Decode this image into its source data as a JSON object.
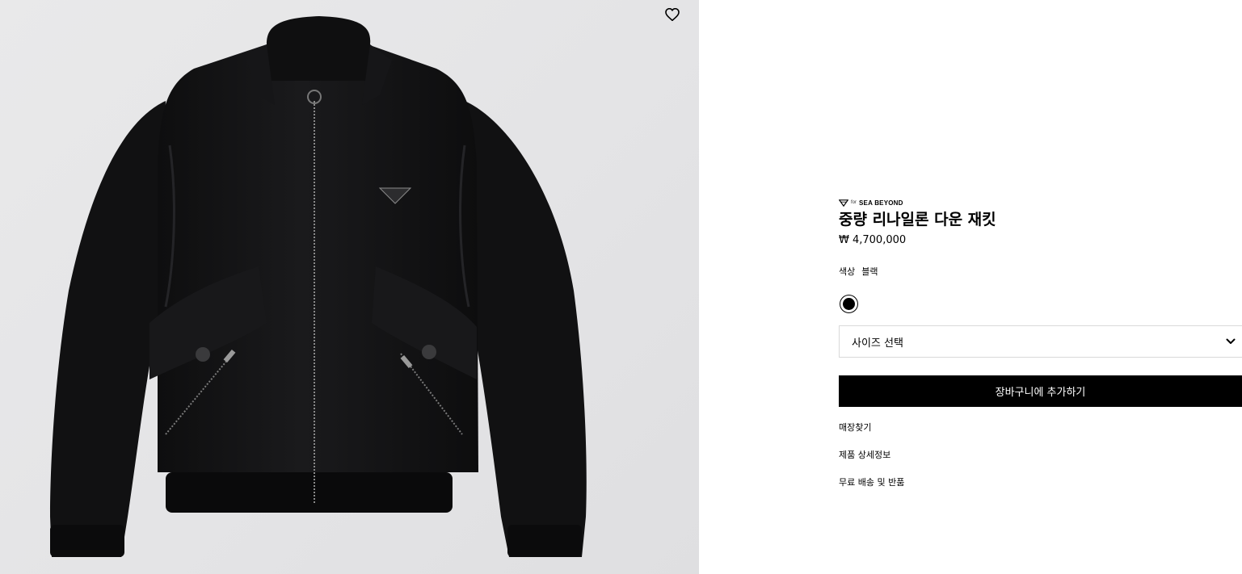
{
  "product": {
    "badge_for": "for",
    "badge_brand": "SEA BEYOND",
    "title": "중량 리나일론 다운 재킷",
    "price": "₩ 4,700,000",
    "color_label": "색상",
    "color_value": "블랙",
    "swatch_color": "#000000",
    "size_select_label": "사이즈 선택",
    "add_to_cart_label": "장바구니에 추가하기"
  },
  "links": {
    "find_store": "매장찾기",
    "product_details": "제품 상세정보",
    "shipping_returns": "무료 배송 및 반품"
  },
  "icons": {
    "wishlist": "heart-outline-icon",
    "dropdown": "chevron-down-icon",
    "brand": "triangle-logo-icon"
  },
  "colors": {
    "panel_bg": "#e6e6e8",
    "jacket": "#121213",
    "button_bg": "#000000",
    "button_text": "#ffffff"
  }
}
